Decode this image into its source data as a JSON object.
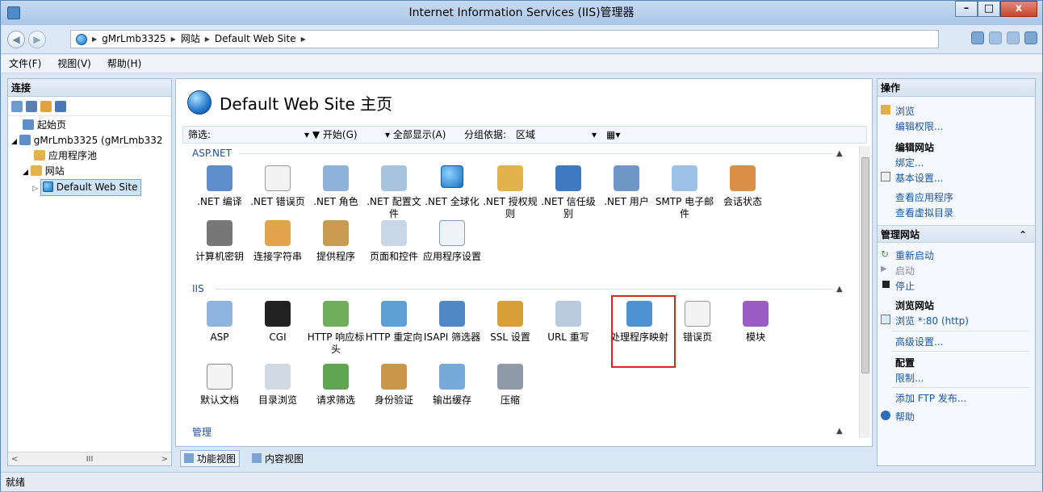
{
  "window": {
    "title": "Internet Information Services (IIS)管理器",
    "min": "–",
    "max": "□",
    "close": "x"
  },
  "address": {
    "segments": [
      "gMrLmb3325",
      "网站",
      "Default Web Site"
    ]
  },
  "menu": [
    "文件(F)",
    "视图(V)",
    "帮助(H)"
  ],
  "left": {
    "header": "连接",
    "tree": [
      "起始页",
      "gMrLmb3325 (gMrLmb332",
      "应用程序池",
      "网站",
      "Default Web Site"
    ],
    "scroll_mid": "III"
  },
  "center": {
    "title": "Default Web Site 主页",
    "filter": {
      "label": "筛选:",
      "start": "▾ ▼ 开始(G)",
      "showall": "▾ 全部显示(A)",
      "groupby_label": "分组依据:",
      "groupby_value": "区域"
    },
    "sections": {
      "aspnet": "ASP.NET",
      "iis": "IIS",
      "manage": "管理"
    },
    "aspnet_items": [
      ".NET 编译",
      ".NET 错误页",
      ".NET 角色",
      ".NET 配置文件",
      ".NET 全球化",
      ".NET 授权规则",
      ".NET 信任级别",
      ".NET 用户",
      "SMTP 电子邮件",
      "会话状态",
      "计算机密钥",
      "连接字符串",
      "提供程序",
      "页面和控件",
      "应用程序设置"
    ],
    "iis_items": [
      "ASP",
      "CGI",
      "HTTP 响应标头",
      "HTTP 重定向",
      "ISAPI 筛选器",
      "SSL 设置",
      "URL 重写",
      "处理程序映射",
      "错误页",
      "模块",
      "默认文档",
      "目录浏览",
      "请求筛选",
      "身份验证",
      "输出缓存",
      "压缩"
    ]
  },
  "tabs": [
    "功能视图",
    "内容视图"
  ],
  "right": {
    "header": "操作",
    "browse": "浏览",
    "edit_perm": "编辑权限...",
    "edit_site": "编辑网站",
    "bind": "绑定...",
    "basic": "基本设置...",
    "view_apps": "查看应用程序",
    "view_vdirs": "查看虚拟目录",
    "manage_site": "管理网站",
    "restart": "重新启动",
    "start": "启动",
    "stop": "停止",
    "browse_site": "浏览网站",
    "browse80": "浏览 *:80 (http)",
    "advanced": "高级设置...",
    "config": "配置",
    "limits": "限制...",
    "ftp": "添加 FTP 发布...",
    "help": "帮助"
  },
  "status": "就绪"
}
